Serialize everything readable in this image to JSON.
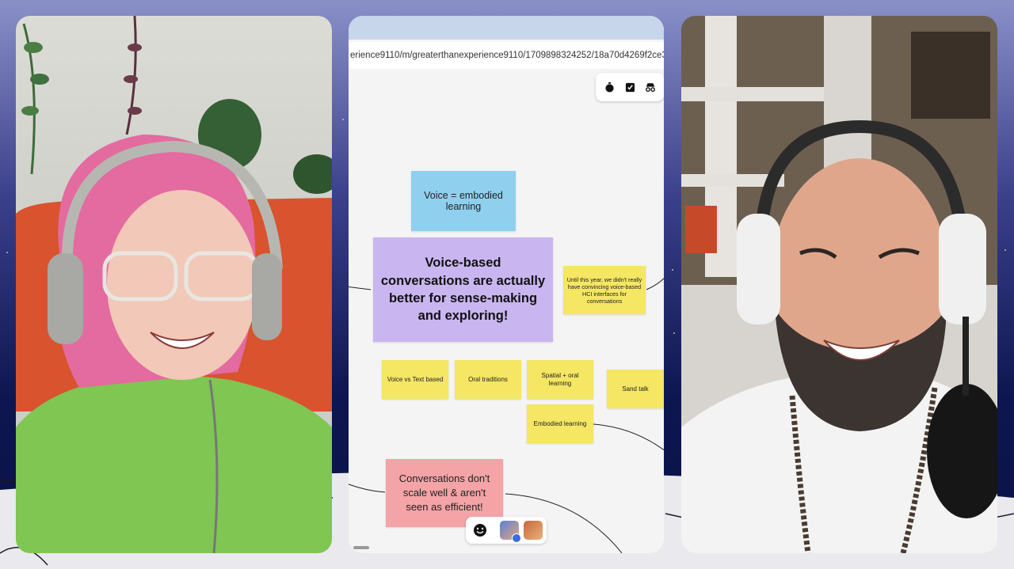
{
  "browser": {
    "url": "erience9110/m/greaterthanexperience9110/1709898324252/18a70d4269f2ce3"
  },
  "toolbar": {
    "icons": [
      "timer-icon",
      "checkbox-icon",
      "incognito-icon"
    ]
  },
  "board": {
    "notes": {
      "voice_embodied": "Voice = embodied learning",
      "main_claim": "Voice-based conversations are actually better for sense-making and exploring!",
      "until_this_year": "Until this year, we didn't really have convincing voice-based HCI interfaces for conversations",
      "voice_vs_text": "Voice vs Text based",
      "oral_traditions": "Oral traditions",
      "spatial_oral": "Spatial + oral learning",
      "sand_talk": "Sand talk",
      "embodied_learning": "Embodied learning",
      "conversations_scale": "Conversations don't scale well & aren't seen as efficient!"
    }
  },
  "colors": {
    "yellow_note": "#f5e663",
    "blue_note": "#8fd0ee",
    "purple_note": "#c9b6f0",
    "pink_note": "#f4a3a6"
  }
}
